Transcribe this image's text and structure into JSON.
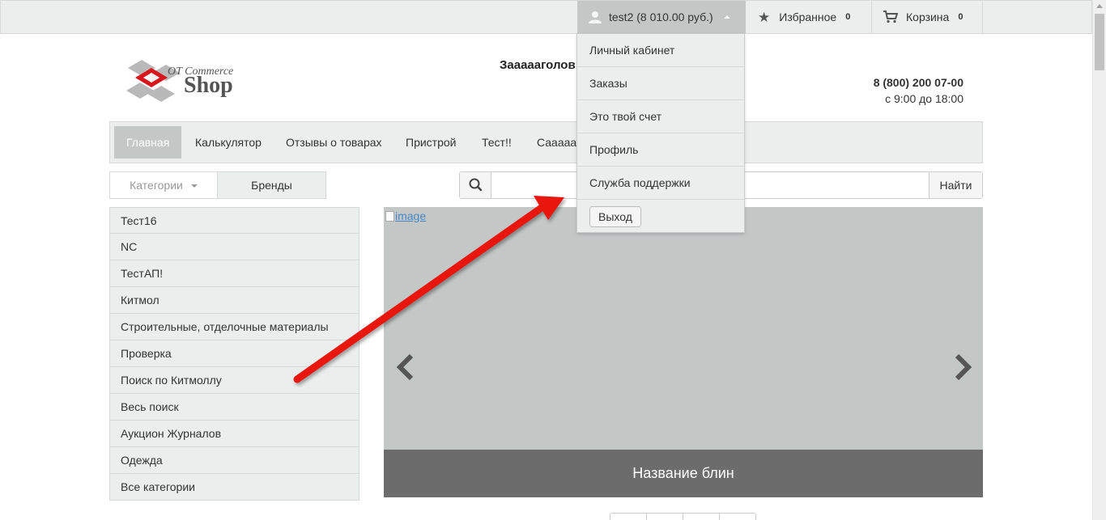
{
  "topbar": {
    "user_label": "test2 (8 010.00 руб.)",
    "favorites_label": "Избранное",
    "favorites_count": "0",
    "cart_label": "Корзина",
    "cart_count": "0"
  },
  "user_menu": {
    "items": [
      "Личный кабинет",
      "Заказы",
      "Это твой счет",
      "Профиль",
      "Служба поддержки"
    ],
    "logout_label": "Выход"
  },
  "header": {
    "logo_line1": "OT Commerce",
    "logo_line2": "Shop",
    "headline": "Заааааголов",
    "phone": "8 (800) 200 07-00",
    "hours": "с 9:00 до 18:00"
  },
  "mainnav": {
    "items": [
      "Главная",
      "Калькулятор",
      "Отзывы о товарах",
      "Пристрой",
      "Тест!!",
      "Саааааа"
    ],
    "active_index": 0
  },
  "catalog_tabs": {
    "categories_label": "Категории",
    "brands_label": "Бренды"
  },
  "search": {
    "value": "",
    "button_label": "Найти"
  },
  "categories": [
    "Тест16",
    "NC",
    "ТестАП!",
    "Китмол",
    "Строительные, отделочные материалы",
    "Проверка",
    "Поиск по Китмоллу",
    "Весь поиск",
    "Аукцион Журналов",
    "Одежда",
    "Все категории"
  ],
  "slider": {
    "image_alt": "image",
    "caption": "Название блин"
  },
  "colors": {
    "bar_bg": "#eceeed",
    "active_bg": "#c3c8c7",
    "caption_bg": "#6b6c6b",
    "annotation_arrow": "#e8120f"
  }
}
